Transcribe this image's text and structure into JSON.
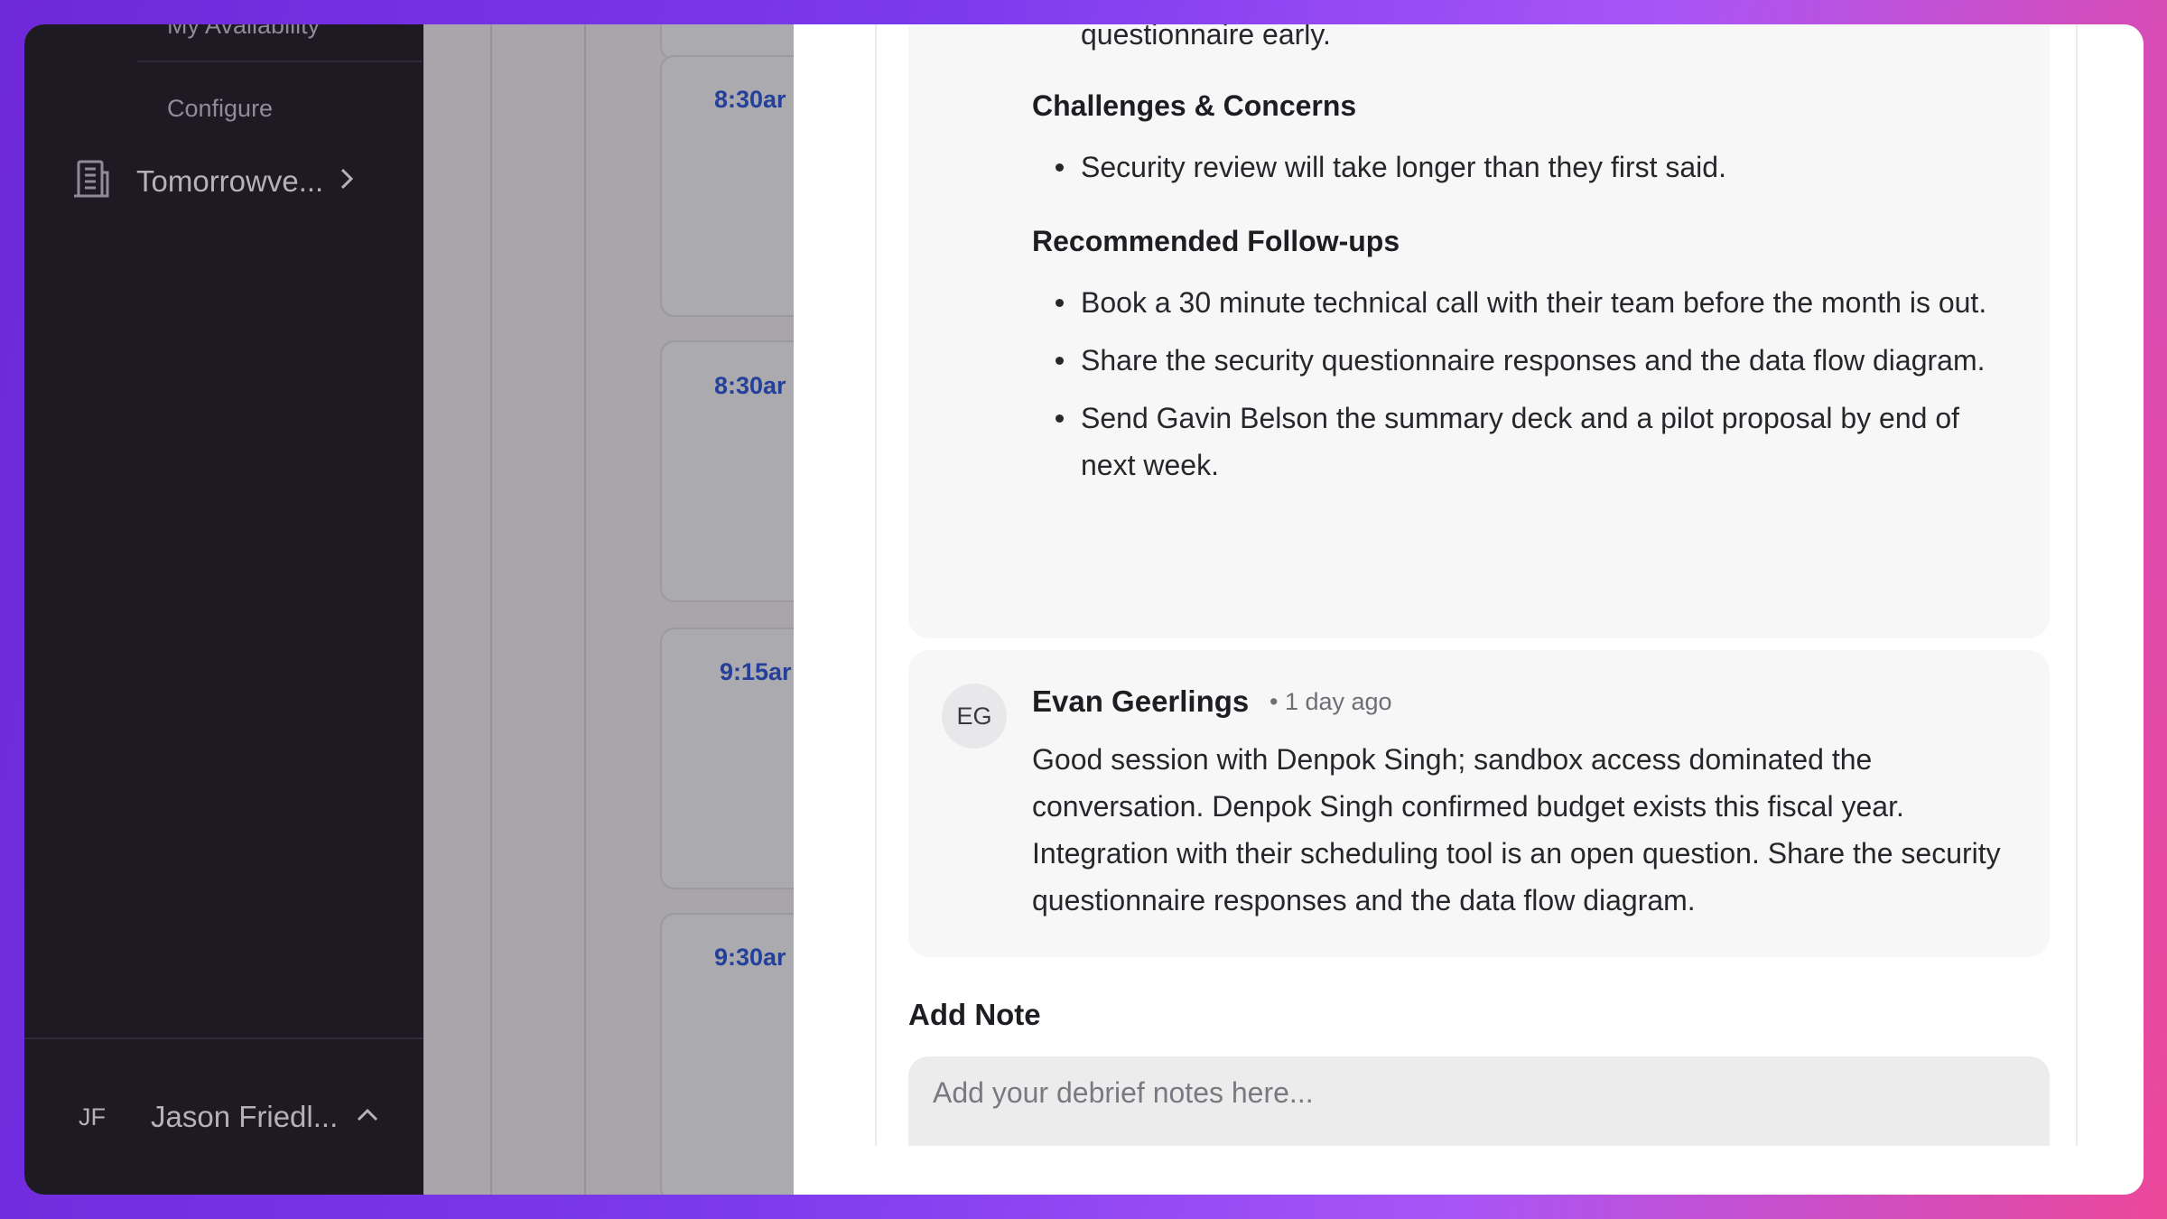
{
  "sidebar": {
    "my_availability": "My Availability",
    "configure": "Configure",
    "org_name": "Tomorrowve...",
    "user_initials": "JF",
    "user_name": "Jason Friedl..."
  },
  "calendar": {
    "event_times": [
      "8:30ar",
      "8:30ar",
      "9:15ar",
      "9:30ar"
    ]
  },
  "summary": {
    "intro_tail": "questionnaire early.",
    "challenges_heading": "Challenges & Concerns",
    "challenges": [
      "Security review will take longer than they first said."
    ],
    "followups_heading": "Recommended Follow-ups",
    "followups": [
      "Book a 30 minute technical call with their team before the month is out.",
      "Share the security questionnaire responses and the data flow diagram.",
      "Send Gavin Belson the summary deck and a pilot proposal by end of next week."
    ]
  },
  "comment": {
    "initials": "EG",
    "author": "Evan Geerlings",
    "timestamp": "• 1 day ago",
    "body": "Good session with Denpok Singh; sandbox access dominated the conversation. Denpok Singh confirmed budget exists this fiscal year. Integration with their scheduling tool is an open question. Share the security questionnaire responses and the data flow diagram."
  },
  "add_note": {
    "label": "Add Note",
    "placeholder": "Add your debrief notes here..."
  },
  "colors": {
    "sidebar_bg": "#1d1a24",
    "event_time": "#24409a",
    "card_bg": "#f7f7f8"
  }
}
